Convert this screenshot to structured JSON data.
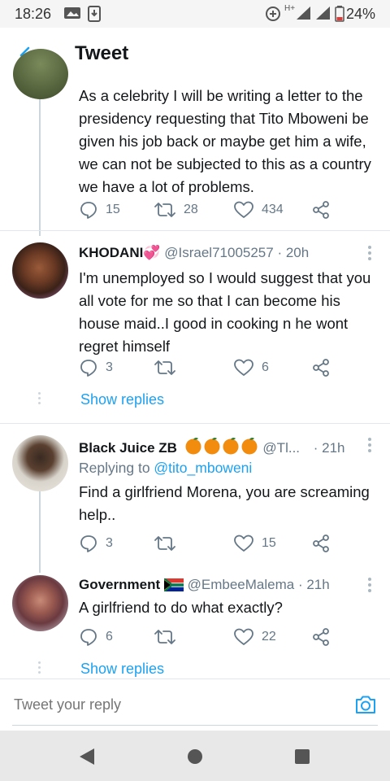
{
  "status_bar": {
    "time": "18:26",
    "battery": "24%",
    "network": "H+"
  },
  "header": {
    "title": "Tweet"
  },
  "tweets": [
    {
      "text": "As a celebrity I will be writing a letter to the presidency requesting that Tito Mboweni be given his job back or maybe get him a wife, we can not be subjected to this as a country we have a lot of problems.",
      "reply_count": "15",
      "retweet_count": "28",
      "like_count": "434"
    },
    {
      "name": "KHODANI",
      "name_emoji": "💞",
      "handle": "@Israel71005257",
      "time": "· 20h",
      "text": "I'm unemployed so I would suggest that you all vote for me so that I can become his house maid..I good in cooking n he wont regret himself",
      "reply_count": "3",
      "retweet_count": "",
      "like_count": "6",
      "show_replies": "Show replies"
    },
    {
      "name": "Black Juice ZB",
      "handle": "@Tl...",
      "time": "· 21h",
      "replying_prefix": "Replying to ",
      "replying_to": "@tito_mboweni",
      "text": "Find a girlfriend Morena, you are screaming help..",
      "reply_count": "3",
      "retweet_count": "",
      "like_count": "15"
    },
    {
      "name": "Government",
      "handle": "@EmbeeMalema",
      "time": "· 21h",
      "text": "A girlfriend to do what exactly?",
      "reply_count": "6",
      "retweet_count": "",
      "like_count": "22",
      "show_replies": "Show replies"
    }
  ],
  "composer": {
    "placeholder": "Tweet your reply"
  },
  "colors": {
    "accent": "#1da1f2",
    "muted": "#657786",
    "orange": "#f28c0f"
  }
}
